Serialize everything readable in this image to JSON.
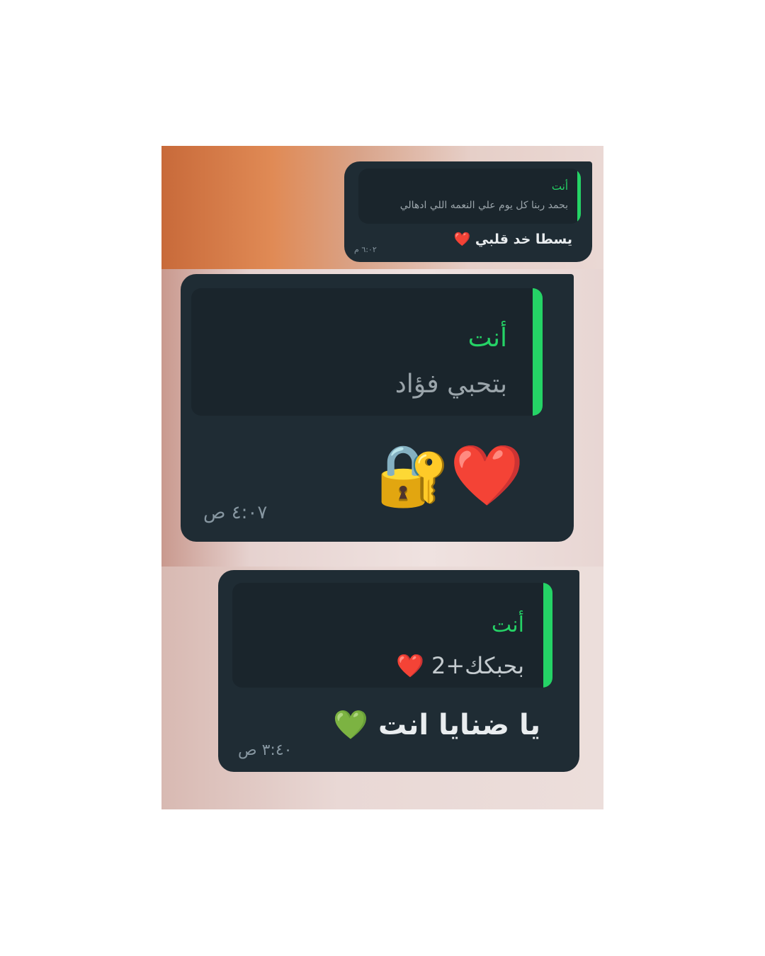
{
  "messages": [
    {
      "quote_author": "أنت",
      "quote_text": "بحمد ربنا كل يوم علي النعمه اللي ادهالي",
      "text": "يسطا خد قلبي",
      "emoji": "❤️",
      "time": "٦:٠٢ م"
    },
    {
      "quote_author": "أنت",
      "quote_text": "بتحبي فؤاد",
      "text": "",
      "emoji": "❤️🔐",
      "time": "٤:٠٧ ص"
    },
    {
      "quote_author": "أنت",
      "quote_text": "بحبكك+2",
      "quote_emoji": "❤️",
      "text": "يا ضنايا انت",
      "emoji": "💚",
      "time": "٣:٤٠ ص"
    }
  ],
  "colors": {
    "bubble": "#1f2c34",
    "accent": "#25d366"
  }
}
